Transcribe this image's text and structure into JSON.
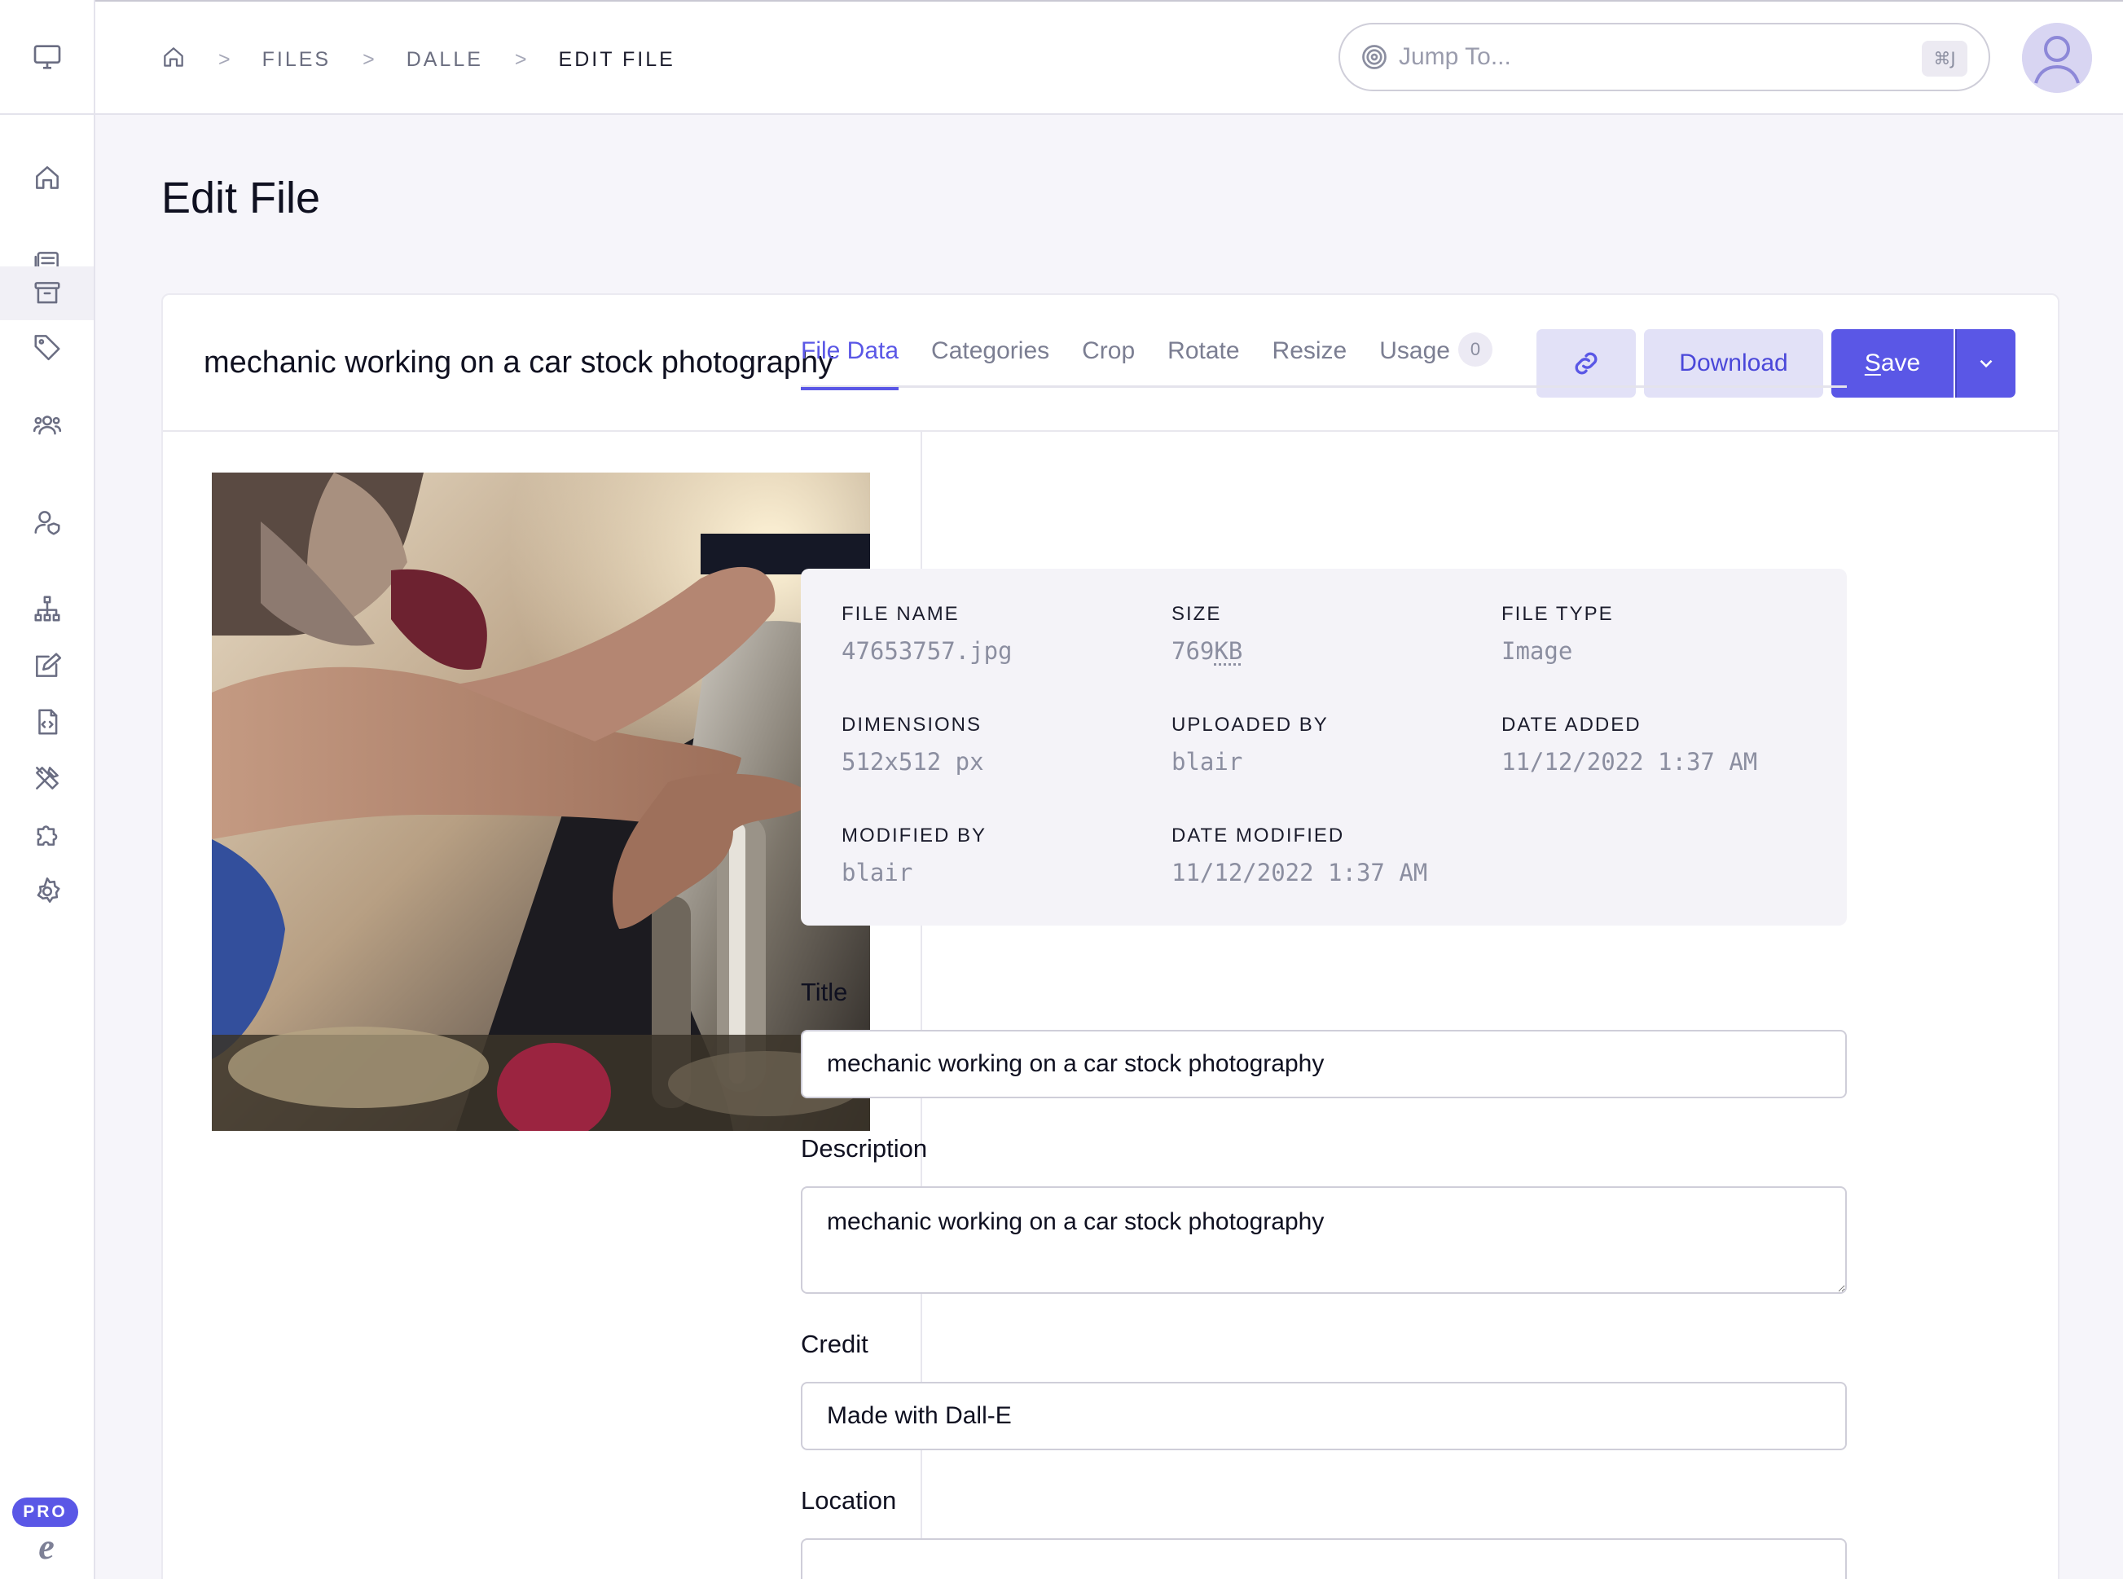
{
  "header": {
    "breadcrumb": [
      {
        "label": "FILES"
      },
      {
        "label": "DALLE"
      },
      {
        "label": "EDIT FILE"
      }
    ],
    "separator": ">",
    "search": {
      "placeholder": "Jump To...",
      "shortcut": "⌘J"
    }
  },
  "sidebar": {
    "icons": [
      "monitor-icon",
      "home-icon",
      "entries-icon",
      "files-icon",
      "categories-icon",
      "members-icon",
      "member-roles-icon",
      "structure-icon",
      "content-edit-icon",
      "templates-icon",
      "tools-icon",
      "addons-icon",
      "settings-icon"
    ],
    "active": "files-icon",
    "badge": "PRO",
    "logo": "e"
  },
  "page": {
    "title": "Edit File"
  },
  "file": {
    "heading": "mechanic working on a car stock photography",
    "actions": {
      "download": "Download",
      "save_prefix": "S",
      "save_rest": "ave"
    }
  },
  "tabs": [
    {
      "label": "File Data",
      "active": true
    },
    {
      "label": "Categories"
    },
    {
      "label": "Crop"
    },
    {
      "label": "Rotate"
    },
    {
      "label": "Resize"
    },
    {
      "label": "Usage",
      "count": "0"
    }
  ],
  "meta": {
    "file_name": {
      "label": "FILE NAME",
      "value": "47653757.jpg"
    },
    "size": {
      "label": "SIZE",
      "value_num": "769",
      "value_unit": "KB"
    },
    "file_type": {
      "label": "FILE TYPE",
      "value": "Image"
    },
    "dimensions": {
      "label": "DIMENSIONS",
      "value": "512x512 px"
    },
    "uploaded_by": {
      "label": "UPLOADED BY",
      "value": "blair"
    },
    "date_added": {
      "label": "DATE ADDED",
      "value": "11/12/2022 1:37 AM"
    },
    "modified_by": {
      "label": "MODIFIED BY",
      "value": "blair"
    },
    "date_modified": {
      "label": "DATE MODIFIED",
      "value": "11/12/2022 1:37 AM"
    }
  },
  "form": {
    "title": {
      "label": "Title",
      "value": "mechanic working on a car stock photography"
    },
    "description": {
      "label": "Description",
      "value": "mechanic working on a car stock photography"
    },
    "credit": {
      "label": "Credit",
      "value": "Made with Dall-E"
    },
    "location": {
      "label": "Location",
      "value": ""
    }
  },
  "colors": {
    "accent": "#5a57e6",
    "accent_soft": "#e2e1f7",
    "background": "#f6f5fa"
  }
}
